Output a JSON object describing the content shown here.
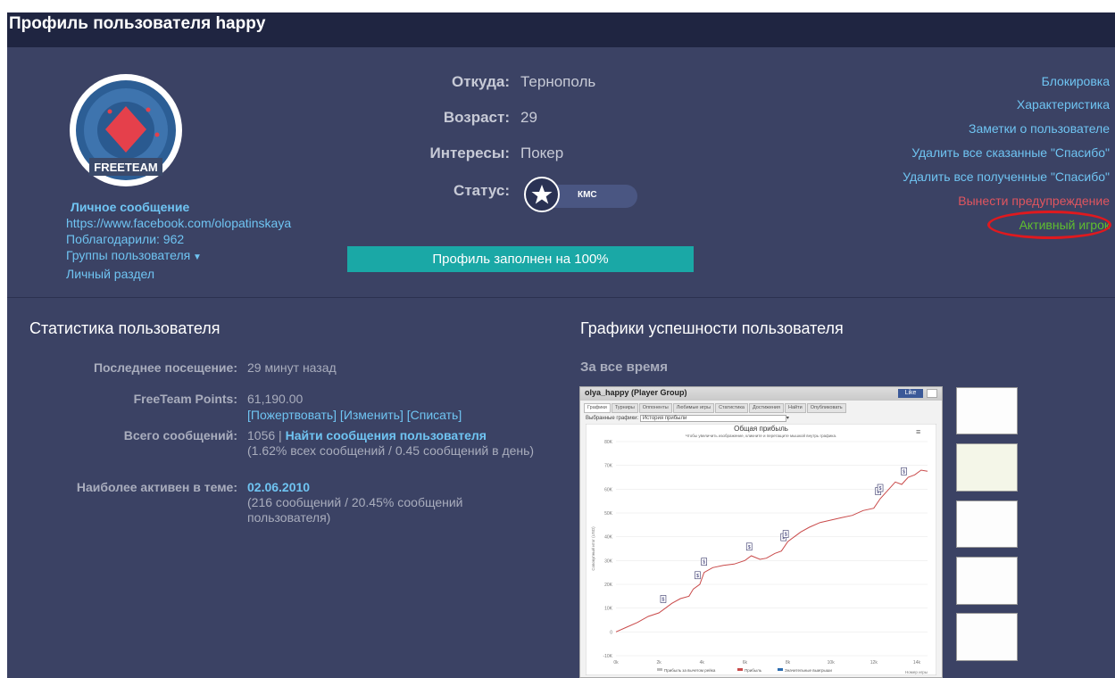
{
  "title": "Профиль пользователя happy",
  "avatar": {
    "logo_text": "FREETEAM"
  },
  "left": {
    "private_message": "Личное сообщение",
    "facebook": "https://www.facebook.com/olopatinskaya",
    "thanked": "Поблагодарили: 962",
    "groups": "Группы пользователя",
    "personal": "Личный раздел"
  },
  "info": {
    "from_label": "Откуда:",
    "from_value": "Тернополь",
    "age_label": "Возраст:",
    "age_value": "29",
    "interests_label": "Интересы:",
    "interests_value": "Покер",
    "status_label": "Статус:",
    "status_badge": "КМС"
  },
  "progress": {
    "label": "Профиль заполнен на 100%",
    "percent": 100
  },
  "right_links": {
    "block": "Блокировка",
    "characteristic": "Характеристика",
    "notes": "Заметки о пользователе",
    "del_said": "Удалить все сказанные \"Спасибо\"",
    "del_received": "Удалить все полученные \"Спасибо\"",
    "warn": "Вынести предупреждение",
    "active": "Активный игрок"
  },
  "stats": {
    "heading": "Статистика пользователя",
    "last_visit_label": "Последнее посещение:",
    "last_visit_value": "29 минут назад",
    "points_label": "FreeTeam Points:",
    "points_value": "61,190.00",
    "points_actions": "[Пожертвовать] [Изменить] [Списать]",
    "posts_label": "Всего сообщений:",
    "posts_count": "1056",
    "posts_sep": "|",
    "posts_link": "Найти сообщения пользователя",
    "posts_note": "(1.62% всех сообщений / 0.45 сообщений в день)",
    "active_label": "Наиболее активен в теме:",
    "active_link": "02.06.2010",
    "active_note": "(216 сообщений / 20.45% сообщений пользователя)"
  },
  "graphs": {
    "heading": "Графики успешности пользователя",
    "period": "За все время"
  },
  "chart_data": {
    "type": "line",
    "header": "olya_happy (Player Group)",
    "like_label": "Like",
    "tabs": [
      "Графики",
      "Турниры",
      "Оппоненты",
      "Любимые игры",
      "Статистика",
      "Достижения",
      "Найти",
      "Опубликовать"
    ],
    "dropdown_label": "Выбранные графики:",
    "dropdown_value": "История прибыли",
    "title": "Общая прибыль",
    "subtitle": "Чтобы увеличить изображение, кликните и перетащите мышкой внутрь графика.",
    "ylabel": "Совокупный итог (USD)",
    "xlabel": "Номер игры",
    "yticks": [
      "80K",
      "70K",
      "60K",
      "50K",
      "40K",
      "30K",
      "20K",
      "10K",
      "0",
      "-10K"
    ],
    "xticks": [
      "0k",
      "2k",
      "4k",
      "6k",
      "8k",
      "10k",
      "12k",
      "14k"
    ],
    "ylim": [
      -10000,
      80000
    ],
    "xlim": [
      0,
      14500
    ],
    "legend": [
      "Прибыль за вычетом рейка",
      "Прибыль",
      "Значительные выигрыши"
    ],
    "series": [
      {
        "name": "Прибыль",
        "x": [
          0,
          500,
          1000,
          1500,
          2000,
          2300,
          2600,
          3000,
          3400,
          3600,
          3900,
          4100,
          4500,
          5000,
          5500,
          6000,
          6300,
          6700,
          7000,
          7400,
          7700,
          8000,
          8300,
          8600,
          9000,
          9500,
          10000,
          10500,
          11000,
          11500,
          12000,
          12300,
          12700,
          13000,
          13300,
          13600,
          13900,
          14200,
          14500
        ],
        "y": [
          0,
          2000,
          4000,
          6500,
          8000,
          10000,
          12000,
          14000,
          15000,
          18000,
          20000,
          25000,
          27000,
          28000,
          28500,
          30000,
          32000,
          30500,
          31000,
          33000,
          34000,
          38000,
          40000,
          42000,
          44000,
          46000,
          47000,
          48000,
          49000,
          51000,
          52000,
          56000,
          60000,
          63000,
          62000,
          65000,
          66000,
          68000,
          67500
        ]
      }
    ],
    "big_wins_x": [
      2200,
      3800,
      4100,
      6200,
      7800,
      7900,
      12200,
      12300,
      13400
    ]
  },
  "colors": {
    "panel": "#3b4264",
    "titlebar": "#1f2541",
    "link": "#6fc4f2",
    "warn": "#e0555f",
    "active": "#5fbf2f",
    "progress": "#1aa8a6",
    "oval": "#e0191e"
  }
}
